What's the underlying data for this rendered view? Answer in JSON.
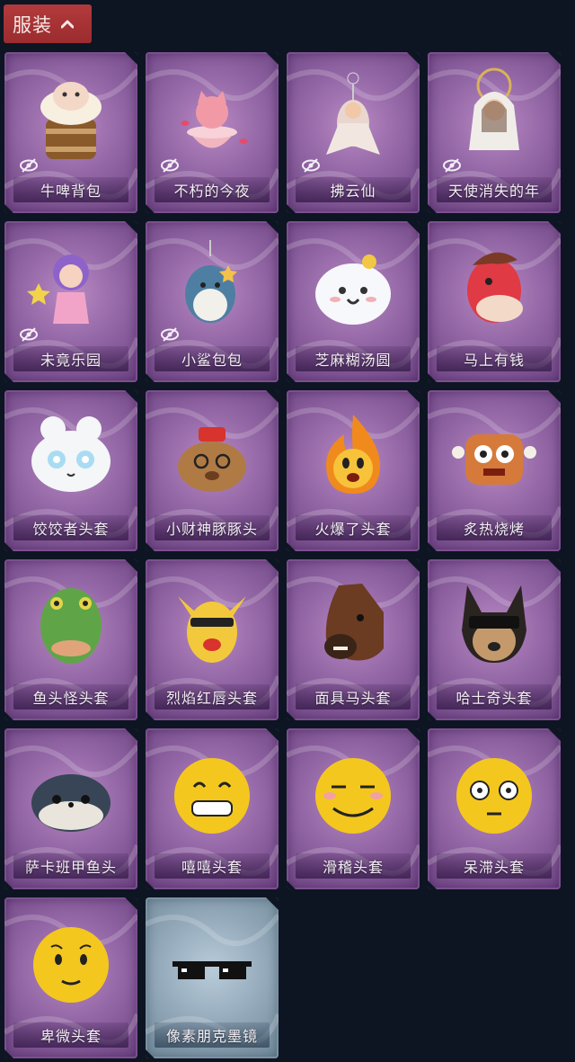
{
  "header": {
    "tab_label": "服装",
    "chevron_icon": "chevron-up-icon",
    "color": "#a83236"
  },
  "items": [
    {
      "name": "牛啤背包",
      "hidden": true,
      "icon": "beer-barrel-cow-backpack",
      "theme": "purple"
    },
    {
      "name": "不朽的今夜",
      "hidden": true,
      "icon": "pink-cat-teacup-charm",
      "theme": "purple"
    },
    {
      "name": "拂云仙",
      "hidden": true,
      "icon": "crystal-fairy-pendant",
      "theme": "purple"
    },
    {
      "name": "天使消失的年",
      "hidden": true,
      "icon": "veiled-angel-doll",
      "theme": "purple"
    },
    {
      "name": "未竟乐园",
      "hidden": true,
      "icon": "star-girl-doll",
      "theme": "purple"
    },
    {
      "name": "小鲨包包",
      "hidden": true,
      "icon": "shark-plush-charm",
      "theme": "purple"
    },
    {
      "name": "芝麻糊汤圆",
      "hidden": false,
      "icon": "smiling-dumpling-head",
      "theme": "purple"
    },
    {
      "name": "马上有钱",
      "hidden": false,
      "icon": "red-horse-head",
      "theme": "purple"
    },
    {
      "name": "饺饺者头套",
      "hidden": false,
      "icon": "dumpling-mask",
      "theme": "purple"
    },
    {
      "name": "小财神豚豚头",
      "hidden": false,
      "icon": "capybara-god-of-wealth-head",
      "theme": "purple"
    },
    {
      "name": "火爆了头套",
      "hidden": false,
      "icon": "fire-spirit-mask",
      "theme": "purple"
    },
    {
      "name": "炙热烧烤",
      "hidden": false,
      "icon": "grilled-meat-mask",
      "theme": "purple"
    },
    {
      "name": "鱼头怪头套",
      "hidden": false,
      "icon": "fish-head-mask",
      "theme": "purple"
    },
    {
      "name": "烈焰红唇头套",
      "hidden": false,
      "icon": "yellow-mouse-lips-mask",
      "theme": "purple"
    },
    {
      "name": "面具马头套",
      "hidden": false,
      "icon": "horse-head-mask",
      "theme": "purple"
    },
    {
      "name": "哈士奇头套",
      "hidden": false,
      "icon": "husky-sunglasses-mask",
      "theme": "purple"
    },
    {
      "name": "萨卡班甲鱼头",
      "hidden": false,
      "icon": "sacabambaspis-head",
      "theme": "purple"
    },
    {
      "name": "嘻嘻头套",
      "hidden": false,
      "icon": "grinning-emoji-head",
      "theme": "purple"
    },
    {
      "name": "滑稽头套",
      "hidden": false,
      "icon": "smirk-emoji-head",
      "theme": "purple"
    },
    {
      "name": "呆滞头套",
      "hidden": false,
      "icon": "dazed-emoji-head",
      "theme": "purple"
    },
    {
      "name": "卑微头套",
      "hidden": false,
      "icon": "humble-emoji-head",
      "theme": "purple"
    },
    {
      "name": "像素朋克墨镜",
      "hidden": false,
      "icon": "pixel-sunglasses",
      "theme": "blue"
    }
  ],
  "colors": {
    "background": "#0d1522",
    "card_purple": "#9467a6",
    "card_blue": "#93a9ba"
  }
}
